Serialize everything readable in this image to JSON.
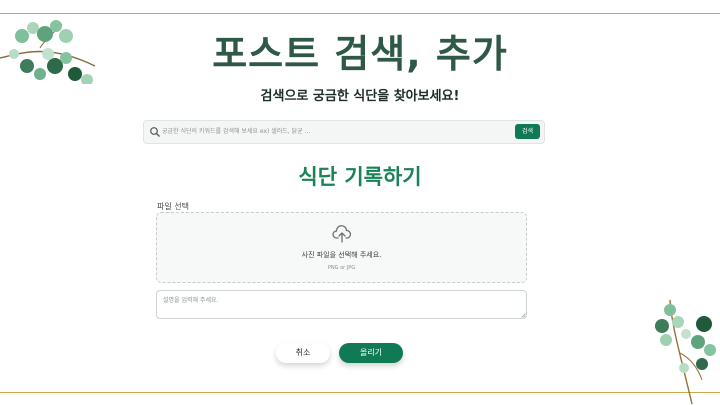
{
  "page": {
    "title": "포스트 검색, 추가",
    "subtitle": "검색으로 궁금한 식단을 찾아보세요!"
  },
  "search": {
    "placeholder": "궁금한 식단의 키워드를 검색해 보세요 ex) 샐러드, 닭균 ...",
    "button_label": "검색"
  },
  "form": {
    "section_title": "식단 기록하기",
    "file_label": "파일 선택",
    "dropzone_text": "사진 파일을 선택해 주세요.",
    "dropzone_hint": "PNG or JPG",
    "description_placeholder": "설명을 입력해 주세요.",
    "cancel_label": "취소",
    "submit_label": "올리기"
  },
  "colors": {
    "title": "#2f5947",
    "accent": "#0f7a54",
    "section_title": "#1a8257",
    "rule": "#c9a84a"
  },
  "icons": {
    "search": "search-icon",
    "upload": "cloud-upload-icon",
    "decoration": "eucalyptus-leaves"
  }
}
